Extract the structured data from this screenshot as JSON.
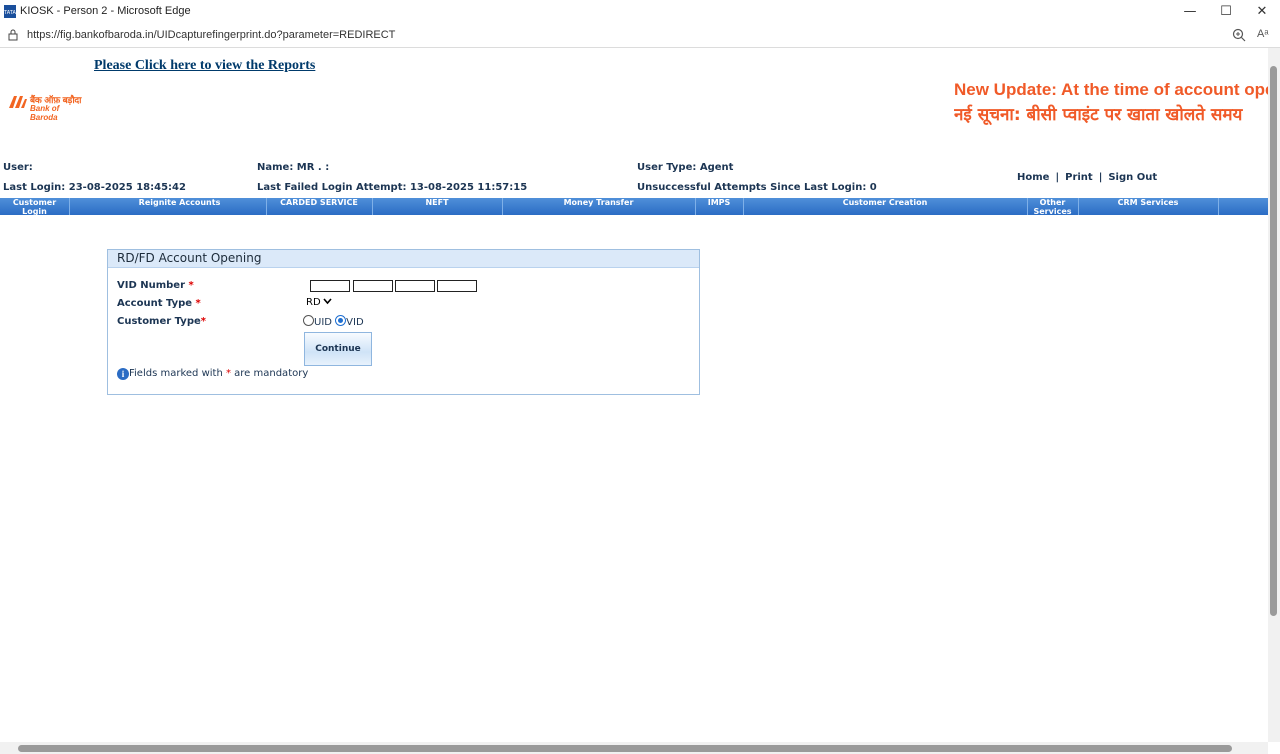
{
  "browser": {
    "window_title": "KIOSK - Person 2 - Microsoft Edge",
    "url": "https://fig.bankofbaroda.in/UIDcapturefingerprint.do?parameter=REDIRECT",
    "read_aloud": "Aᵃ"
  },
  "header": {
    "reports_link": "Please Click here to view the Reports",
    "logo_hindi": "बैंक ऑफ़ बड़ौदा",
    "logo_english": "Bank of Baroda",
    "marquee_line1": "New Update: At the time of account ope",
    "marquee_line2": "नई सूचना: बीसी प्वाइंट पर खाता खोलते समय"
  },
  "user_info": {
    "user": "User:",
    "name": "Name:  MR . :",
    "user_type": "User Type:  Agent",
    "last_login": "Last Login: 23-08-2025 18:45:42",
    "last_failed": "Last Failed Login Attempt:  13-08-2025 11:57:15",
    "unsuccessful": "Unsuccessful Attempts Since Last Login: 0",
    "links": {
      "home": "Home",
      "print": "Print",
      "sign_out": "Sign Out",
      "sep": "|"
    }
  },
  "menu": [
    "Customer Login",
    "Reignite Accounts",
    "CARDED SERVICE",
    "NEFT",
    "Money Transfer",
    "IMPS",
    "Customer Creation",
    "Other Services",
    "CRM Services"
  ],
  "form": {
    "title": "RD/FD Account Opening",
    "vid_label": "VID Number",
    "account_type_label": "Account Type",
    "account_type_value": "RD",
    "customer_type_label": "Customer Type",
    "uid_label": "UID",
    "vid_option": "VID",
    "selected_customer_type": "VID",
    "continue": "Continue",
    "note_prefix": "Fields marked with",
    "note_suffix": "are mandatory",
    "required_mark": "*"
  },
  "colors": {
    "accent_orange": "#f05a28",
    "menu_blue": "#2b6cc4",
    "text_navy": "#1c3553"
  }
}
